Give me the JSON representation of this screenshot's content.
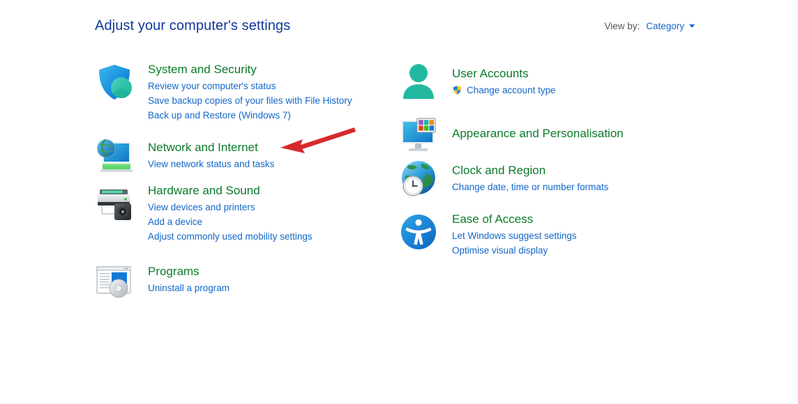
{
  "header": {
    "title": "Adjust your computer's settings",
    "view_by_label": "View by:",
    "view_by_value": "Category",
    "caret_icon": "chevron-down-icon"
  },
  "colors": {
    "title": "#11399b",
    "category_heading": "#0b7a2a",
    "link": "#1267c8",
    "muted_label": "#555555",
    "annotation": "#d6292b",
    "background": "#ffffff"
  },
  "left_column": [
    {
      "id": "system-and-security",
      "icon": "shield-pie-icon",
      "title": "System and Security",
      "links": [
        "Review your computer's status",
        "Save backup copies of your files with File History",
        "Back up and Restore (Windows 7)"
      ]
    },
    {
      "id": "network-and-internet",
      "icon": "monitor-globe-icon",
      "title": "Network and Internet",
      "links": [
        "View network status and tasks"
      ]
    },
    {
      "id": "hardware-and-sound",
      "icon": "printer-speaker-icon",
      "title": "Hardware and Sound",
      "links": [
        "View devices and printers",
        "Add a device",
        "Adjust commonly used mobility settings"
      ]
    },
    {
      "id": "programs",
      "icon": "window-disc-icon",
      "title": "Programs",
      "links": [
        "Uninstall a program"
      ]
    }
  ],
  "right_column": [
    {
      "id": "user-accounts",
      "icon": "user-person-icon",
      "title": "User Accounts",
      "links": [
        "Change account type"
      ],
      "link_shield_icon": "uac-shield-icon"
    },
    {
      "id": "appearance-and-personalisation",
      "icon": "monitor-palette-icon",
      "title": "Appearance and Personalisation",
      "links": []
    },
    {
      "id": "clock-and-region",
      "icon": "globe-clock-icon",
      "title": "Clock and Region",
      "links": [
        "Change date, time or number formats"
      ]
    },
    {
      "id": "ease-of-access",
      "icon": "accessibility-icon",
      "title": "Ease of Access",
      "links": [
        "Let Windows suggest settings",
        "Optimise visual display"
      ]
    }
  ],
  "annotation": {
    "type": "arrow",
    "name": "red-arrow-annotation",
    "points_to": "Network and Internet",
    "color": "#d6292b"
  }
}
